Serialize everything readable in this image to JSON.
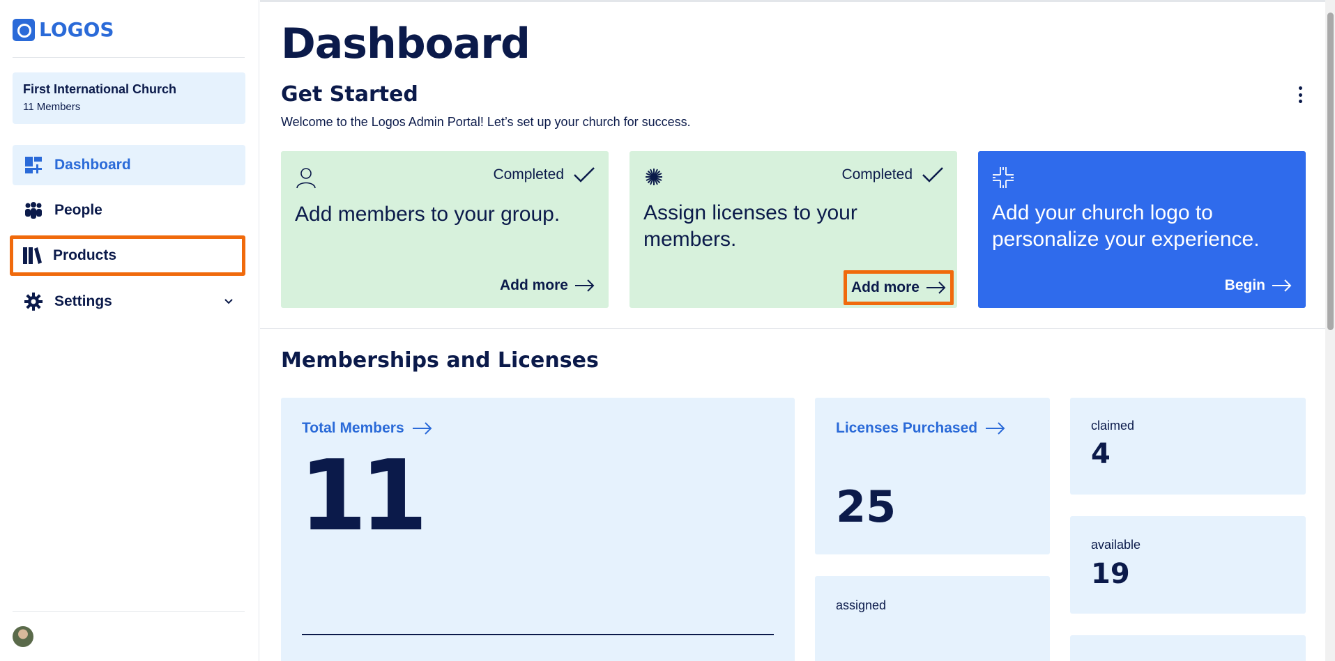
{
  "brand": {
    "name": "LOGOS",
    "color": "#2a6ad8"
  },
  "church": {
    "name": "First International Church",
    "members": "11 Members"
  },
  "nav": [
    {
      "label": "Dashboard",
      "icon": "dashboard-icon",
      "active": true
    },
    {
      "label": "People",
      "icon": "people-icon"
    },
    {
      "label": "Products",
      "icon": "books-icon",
      "highlighted": true
    },
    {
      "label": "Settings",
      "icon": "gear-icon",
      "expandable": true
    }
  ],
  "page": {
    "title": "Dashboard",
    "get_started": {
      "title": "Get Started",
      "welcome": "Welcome to the Logos Admin Portal! Let’s set up your church for success."
    },
    "cards": [
      {
        "status": "Completed",
        "text": "Add members to your group.",
        "action": "Add more",
        "icon": "person-icon"
      },
      {
        "status": "Completed",
        "text": "Assign licenses to your members.",
        "action": "Add more",
        "icon": "starburst-icon",
        "highlighted": true
      },
      {
        "text": "Add your church logo to personalize your experience.",
        "action": "Begin",
        "icon": "cross-icon"
      }
    ],
    "memberships": {
      "title": "Memberships and Licenses",
      "total_members": {
        "label": "Total Members",
        "value": "11"
      },
      "licenses": {
        "label": "Licenses Purchased",
        "value": "25"
      },
      "claimed": {
        "label": "claimed",
        "value": "4"
      },
      "available": {
        "label": "available",
        "value": "19"
      },
      "assigned": {
        "label": "assigned"
      }
    }
  },
  "colors": {
    "accent": "#2a6ad8",
    "navy": "#0b1a4a",
    "light_blue": "#e6f2fd",
    "completed_green": "#d7f1dc",
    "cta_blue": "#2f6bec",
    "highlight_orange": "#f06a0c"
  }
}
